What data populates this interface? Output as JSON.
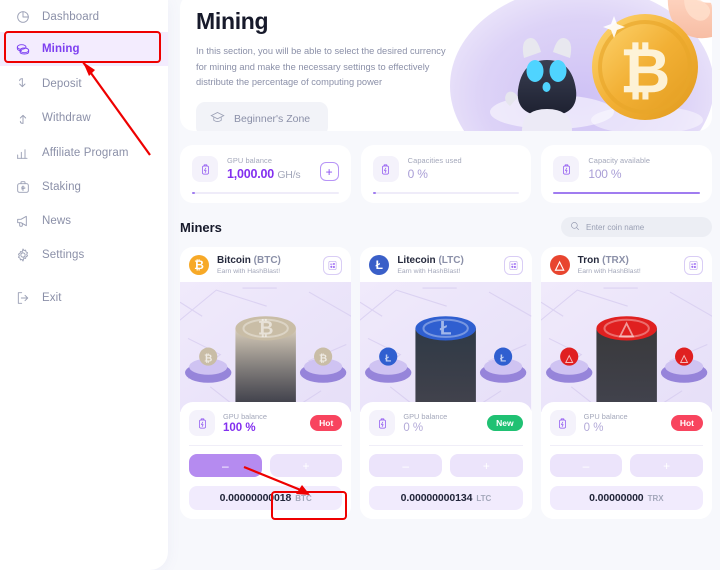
{
  "sidebar": {
    "items": [
      {
        "label": "Dashboard",
        "icon": "pie-chart-icon",
        "active": false
      },
      {
        "label": "Mining",
        "icon": "coins-icon",
        "active": true
      },
      {
        "label": "Deposit",
        "icon": "arrow-down-icon",
        "active": false
      },
      {
        "label": "Withdraw",
        "icon": "arrow-up-icon",
        "active": false
      },
      {
        "label": "Affiliate Program",
        "icon": "bar-chart-icon",
        "active": false
      },
      {
        "label": "Staking",
        "icon": "briefcase-dollar-icon",
        "active": false
      },
      {
        "label": "News",
        "icon": "megaphone-icon",
        "active": false
      },
      {
        "label": "Settings",
        "icon": "gear-icon",
        "active": false
      },
      {
        "label": "Exit",
        "icon": "logout-icon",
        "active": false
      }
    ]
  },
  "banner": {
    "title": "Mining",
    "description": "In this section, you will be able to select the desired currency for mining and make the necessary settings to effectively distribute the percentage of computing power",
    "button_label": "Beginner's Zone",
    "button_icon": "graduation-cap-icon"
  },
  "stats": [
    {
      "label": "GPU balance",
      "value": "1,000.00",
      "unit": "GH/s",
      "icon": "battery-bolt-icon",
      "has_plus": true,
      "progress": 0
    },
    {
      "label": "Capacities used",
      "value": "0 %",
      "unit": "",
      "icon": "battery-bolt-icon",
      "has_plus": false,
      "progress": 0
    },
    {
      "label": "Capacity available",
      "value": "100 %",
      "unit": "",
      "icon": "battery-bolt-icon",
      "has_plus": false,
      "progress": 100
    }
  ],
  "miners": {
    "title": "Miners",
    "search_placeholder": "Enter coin name",
    "search_value": "",
    "search_icon": "search-icon",
    "cards": [
      {
        "name": "Bitcoin",
        "ticker": "(BTC)",
        "subtitle": "Earn with HashBlast!",
        "symbol": "₿",
        "badge_color": "#f7a927",
        "calc_icon": "calculator-icon",
        "gpu_label": "GPU balance",
        "gpu_value": "100 %",
        "gpu_full": true,
        "tag": "Hot",
        "tag_type": "hot",
        "minus_label": "–",
        "plus_label": "+",
        "amount": "0.00000000018",
        "amount_symbol": "BTC",
        "coin_color": "#d8cdbb",
        "coin_top": "#c9bda6"
      },
      {
        "name": "Litecoin",
        "ticker": "(LTC)",
        "subtitle": "Earn with HashBlast!",
        "symbol": "Ł",
        "badge_color": "#3a5fc8",
        "calc_icon": "calculator-icon",
        "gpu_label": "GPU balance",
        "gpu_value": "0 %",
        "gpu_full": false,
        "tag": "New",
        "tag_type": "new",
        "minus_label": "–",
        "plus_label": "+",
        "amount": "0.00000000134",
        "amount_symbol": "LTC",
        "coin_color": "#2f3a47",
        "coin_top": "#2f5fd0"
      },
      {
        "name": "Tron",
        "ticker": "(TRX)",
        "subtitle": "Earn with HashBlast!",
        "symbol": "△",
        "badge_color": "#e8452f",
        "calc_icon": "calculator-icon",
        "gpu_label": "GPU balance",
        "gpu_value": "0 %",
        "gpu_full": false,
        "tag": "Hot",
        "tag_type": "hot",
        "minus_label": "–",
        "plus_label": "+",
        "amount": "0.00000000",
        "amount_symbol": "TRX",
        "coin_color": "#3a3a3c",
        "coin_top": "#e02020"
      }
    ]
  },
  "annotations": {
    "color": "#ee0000",
    "highlights": [
      "mining-nav-item",
      "bitcoin-plus-button"
    ]
  }
}
